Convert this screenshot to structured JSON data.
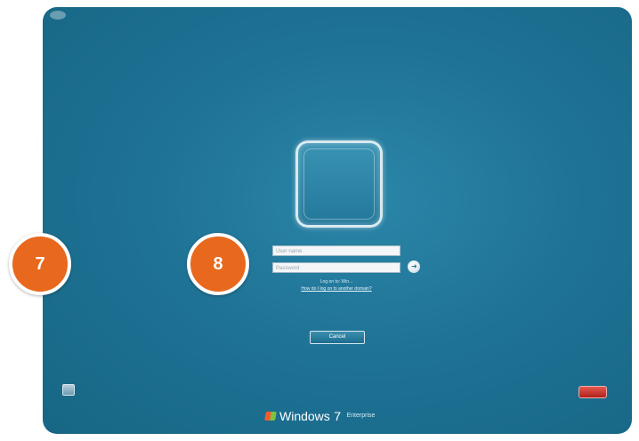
{
  "login": {
    "username_placeholder": "User name",
    "password_placeholder": "Password",
    "logon_to": "Log on to: Win...",
    "how_to_link": "How do I log on to another domain?",
    "cancel_label": "Cancel"
  },
  "branding": {
    "product": "Windows",
    "version": "7",
    "edition": "Enterprise"
  },
  "callouts": {
    "badge_7": "7",
    "badge_8": "8"
  },
  "icons": {
    "go": "arrow-right-icon",
    "ease_of_access": "ease-of-access-icon",
    "shutdown": "power-icon",
    "logo": "windows-flag-icon"
  },
  "colors": {
    "background": "#1f7396",
    "badge": "#e8681d",
    "shutdown": "#c8322b"
  }
}
